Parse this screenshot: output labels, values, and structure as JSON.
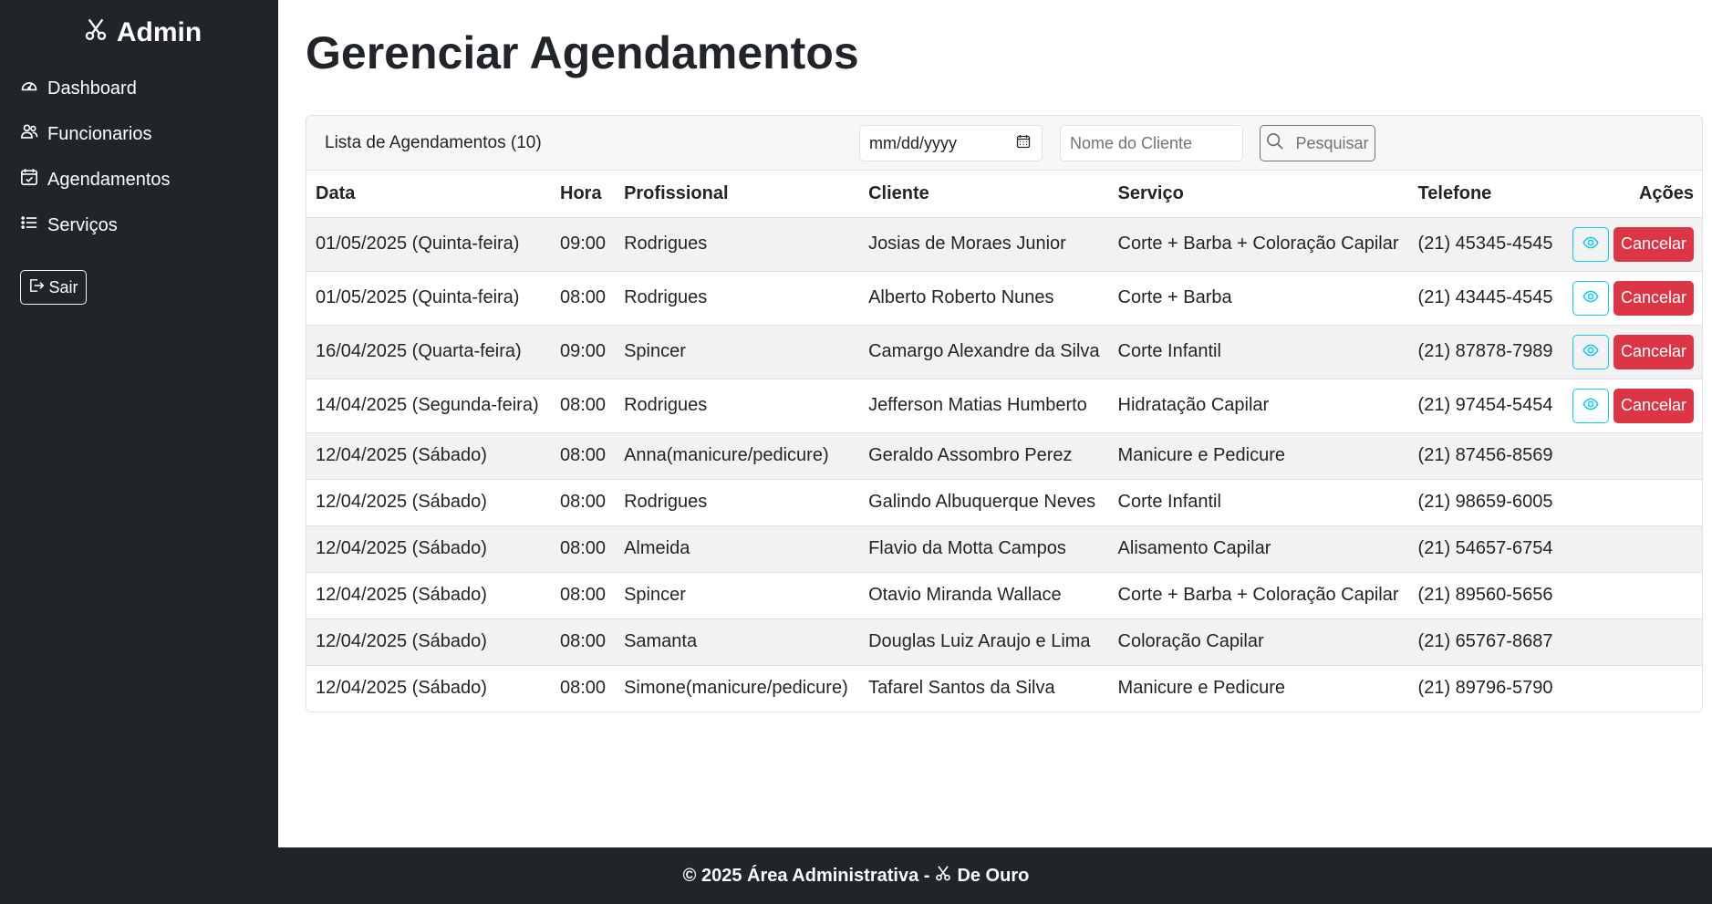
{
  "sidebar": {
    "brand": "Admin",
    "brand_icon": "scissors-icon",
    "items": [
      {
        "label": "Dashboard",
        "icon": "speedometer-icon"
      },
      {
        "label": "Funcionarios",
        "icon": "people-icon"
      },
      {
        "label": "Agendamentos",
        "icon": "calendar-check-icon"
      },
      {
        "label": "Serviços",
        "icon": "list-icon"
      }
    ],
    "logout_label": "Sair",
    "logout_icon": "logout-icon"
  },
  "page": {
    "title": "Gerenciar Agendamentos"
  },
  "card": {
    "title": "Lista de Agendamentos (10)",
    "date_placeholder": "mm/dd/yyyy",
    "name_placeholder": "Nome do Cliente",
    "search_label": "Pesquisar"
  },
  "table": {
    "headers": [
      "Data",
      "Hora",
      "Profissional",
      "Cliente",
      "Serviço",
      "Telefone",
      "Ações"
    ],
    "rows": [
      {
        "data": "01/05/2025 (Quinta-feira)",
        "hora": "09:00",
        "profissional": "Rodrigues",
        "cliente": "Josias de Moraes Junior",
        "servico": "Corte + Barba + Coloração Capilar",
        "telefone": "(21) 45345-4545",
        "actions": true
      },
      {
        "data": "01/05/2025 (Quinta-feira)",
        "hora": "08:00",
        "profissional": "Rodrigues",
        "cliente": "Alberto Roberto Nunes",
        "servico": "Corte + Barba",
        "telefone": "(21) 43445-4545",
        "actions": true
      },
      {
        "data": "16/04/2025 (Quarta-feira)",
        "hora": "09:00",
        "profissional": "Spincer",
        "cliente": "Camargo Alexandre da Silva",
        "servico": "Corte Infantil",
        "telefone": "(21) 87878-7989",
        "actions": true
      },
      {
        "data": "14/04/2025 (Segunda-feira)",
        "hora": "08:00",
        "profissional": "Rodrigues",
        "cliente": "Jefferson Matias Humberto",
        "servico": "Hidratação Capilar",
        "telefone": "(21) 97454-5454",
        "actions": true
      },
      {
        "data": "12/04/2025 (Sábado)",
        "hora": "08:00",
        "profissional": "Anna(manicure/pedicure)",
        "cliente": "Geraldo Assombro Perez",
        "servico": "Manicure e Pedicure",
        "telefone": "(21) 87456-8569",
        "actions": false
      },
      {
        "data": "12/04/2025 (Sábado)",
        "hora": "08:00",
        "profissional": "Rodrigues",
        "cliente": "Galindo Albuquerque Neves",
        "servico": "Corte Infantil",
        "telefone": "(21) 98659-6005",
        "actions": false
      },
      {
        "data": "12/04/2025 (Sábado)",
        "hora": "08:00",
        "profissional": "Almeida",
        "cliente": "Flavio da Motta Campos",
        "servico": "Alisamento Capilar",
        "telefone": "(21) 54657-6754",
        "actions": false
      },
      {
        "data": "12/04/2025 (Sábado)",
        "hora": "08:00",
        "profissional": "Spincer",
        "cliente": "Otavio Miranda Wallace",
        "servico": "Corte + Barba + Coloração Capilar",
        "telefone": "(21) 89560-5656",
        "actions": false
      },
      {
        "data": "12/04/2025 (Sábado)",
        "hora": "08:00",
        "profissional": "Samanta",
        "cliente": "Douglas Luiz Araujo e Lima",
        "servico": "Coloração Capilar",
        "telefone": "(21) 65767-8687",
        "actions": false
      },
      {
        "data": "12/04/2025 (Sábado)",
        "hora": "08:00",
        "profissional": "Simone(manicure/pedicure)",
        "cliente": "Tafarel Santos da Silva",
        "servico": "Manicure e Pedicure",
        "telefone": "(21) 89796-5790",
        "actions": false
      }
    ],
    "view_icon": "eye-icon",
    "cancel_label": "Cancelar"
  },
  "footer": {
    "prefix": "© 2025 Área Administrativa -",
    "suffix": "De Ouro",
    "icon": "scissors-icon"
  },
  "colors": {
    "sidebar_bg": "#212529",
    "danger": "#dc3545",
    "info": "#0dcaf0",
    "stripe": "#f2f2f2"
  }
}
